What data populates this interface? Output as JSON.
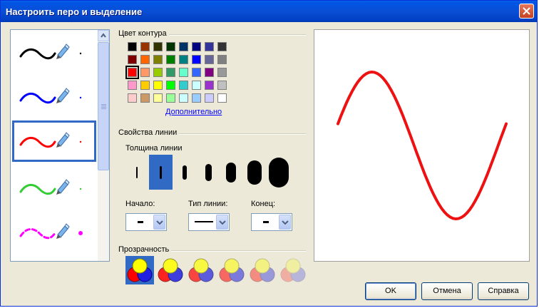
{
  "window": {
    "title": "Настроить перо и выделение"
  },
  "pens": [
    {
      "color": "#000000",
      "style": "solid"
    },
    {
      "color": "#0000ff",
      "style": "solid"
    },
    {
      "color": "#ff0000",
      "style": "solid",
      "selected": true
    },
    {
      "color": "#33cc33",
      "style": "solid"
    },
    {
      "color": "#ff00ff",
      "style": "dashed"
    }
  ],
  "outline_color": {
    "label": "Цвет контура",
    "swatches": [
      [
        "#000000",
        "#993300",
        "#333300",
        "#003300",
        "#003366",
        "#000080",
        "#333399",
        "#333333"
      ],
      [
        "#800000",
        "#ff6600",
        "#808000",
        "#008000",
        "#008080",
        "#0000ff",
        "#666699",
        "#808080"
      ],
      [
        "#ff0000",
        "#ff9966",
        "#99cc00",
        "#339966",
        "#66ffcc",
        "#3366ff",
        "#800080",
        "#999999"
      ],
      [
        "#ff99cc",
        "#ffcc00",
        "#ffff00",
        "#00ff00",
        "#33cccc",
        "#ccffff",
        "#9933cc",
        "#c0c0c0"
      ],
      [
        "#ffcccc",
        "#cc9966",
        "#ffff99",
        "#99ff99",
        "#ccffff",
        "#99ccff",
        "#ccccff",
        "#ffffff"
      ]
    ],
    "selected_color": "#ff0000",
    "more_link": "Дополнительно"
  },
  "line_props": {
    "label": "Свойства линии",
    "thickness_label": "Толщина линии",
    "start_label": "Начало:",
    "type_label": "Тип линии:",
    "end_label": "Конец:"
  },
  "transparency": {
    "label": "Прозрачность",
    "levels": [
      1.0,
      0.85,
      0.7,
      0.55,
      0.4,
      0.25
    ]
  },
  "buttons": {
    "ok": "OK",
    "cancel": "Отмена",
    "help": "Справка"
  },
  "preview": {
    "stroke_color": "#ee1111"
  }
}
